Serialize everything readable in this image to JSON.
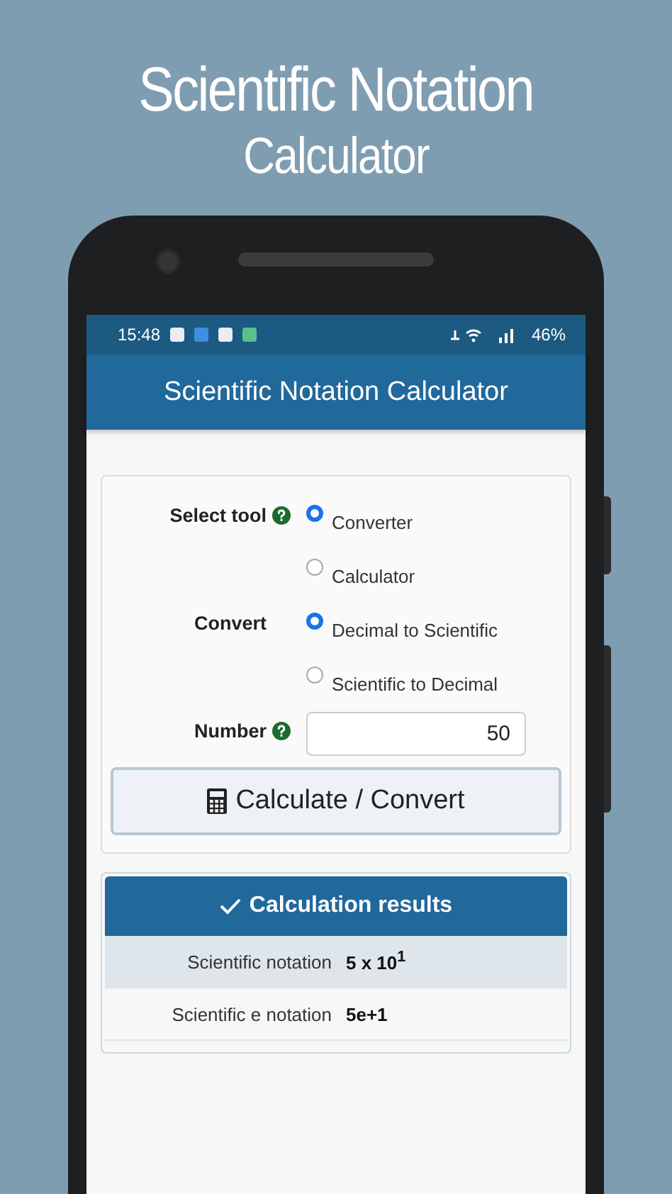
{
  "page_title": "Scientific Notation",
  "page_subtitle": "Calculator",
  "status_bar": {
    "time": "15:48",
    "battery": "46%"
  },
  "app_bar": {
    "title": "Scientific Notation Calculator"
  },
  "form": {
    "groups": [
      {
        "label": "Select tool",
        "help": true,
        "options": [
          {
            "label": "Converter",
            "selected": true
          },
          {
            "label": "Calculator",
            "selected": false
          }
        ]
      },
      {
        "label": "Convert",
        "help": false,
        "options": [
          {
            "label": "Decimal to Scientific",
            "selected": true
          },
          {
            "label": "Scientific to Decimal",
            "selected": false
          }
        ]
      }
    ],
    "number": {
      "label": "Number",
      "help": true,
      "value": "50"
    },
    "button": "Calculate / Convert"
  },
  "results": {
    "title": "Calculation results",
    "rows": [
      {
        "label": "Scientific notation",
        "value": "5 x 10$^{1}$"
      },
      {
        "label": "Scientific e notation",
        "value": "5e+1"
      }
    ]
  }
}
